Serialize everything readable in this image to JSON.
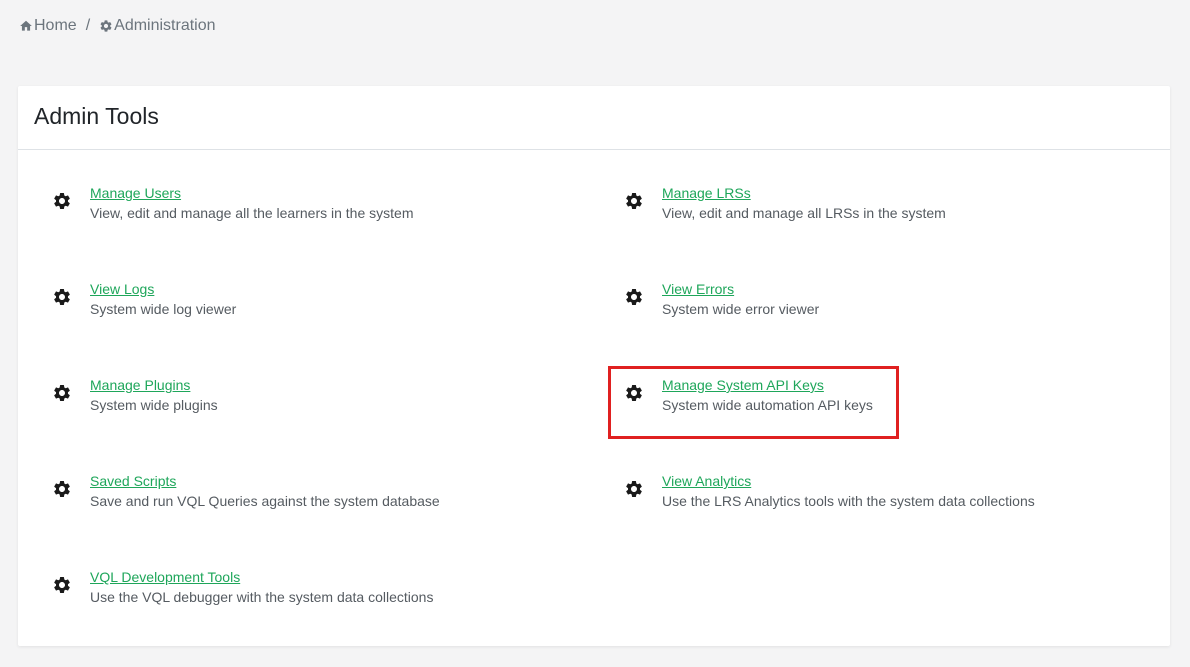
{
  "breadcrumb": {
    "home_label": "Home",
    "home_icon": "home-icon",
    "separator": "/",
    "admin_label": "Administration",
    "admin_icon": "gear-icon"
  },
  "card": {
    "title": "Admin Tools"
  },
  "tools": [
    {
      "icon": "gear-icon",
      "label": "Manage Users",
      "description": "View, edit and manage all the learners in the system"
    },
    {
      "icon": "gear-icon",
      "label": "Manage LRSs",
      "description": "View, edit and manage all LRSs in the system"
    },
    {
      "icon": "gear-icon",
      "label": "View Logs",
      "description": "System wide log viewer"
    },
    {
      "icon": "gear-icon",
      "label": "View Errors",
      "description": "System wide error viewer"
    },
    {
      "icon": "gear-icon",
      "label": "Manage Plugins",
      "description": "System wide plugins"
    },
    {
      "icon": "gear-icon",
      "label": "Manage System API Keys",
      "description": "System wide automation API keys"
    },
    {
      "icon": "gear-icon",
      "label": "Saved Scripts",
      "description": "Save and run VQL Queries against the system database"
    },
    {
      "icon": "gear-icon",
      "label": "View Analytics",
      "description": "Use the LRS Analytics tools with the system data collections"
    },
    {
      "icon": "gear-icon",
      "label": "VQL Development Tools",
      "description": "Use the VQL debugger with the system data collections"
    }
  ],
  "colors": {
    "link": "#1ea65a",
    "highlight": "#e02020",
    "background": "#f4f4f5"
  }
}
